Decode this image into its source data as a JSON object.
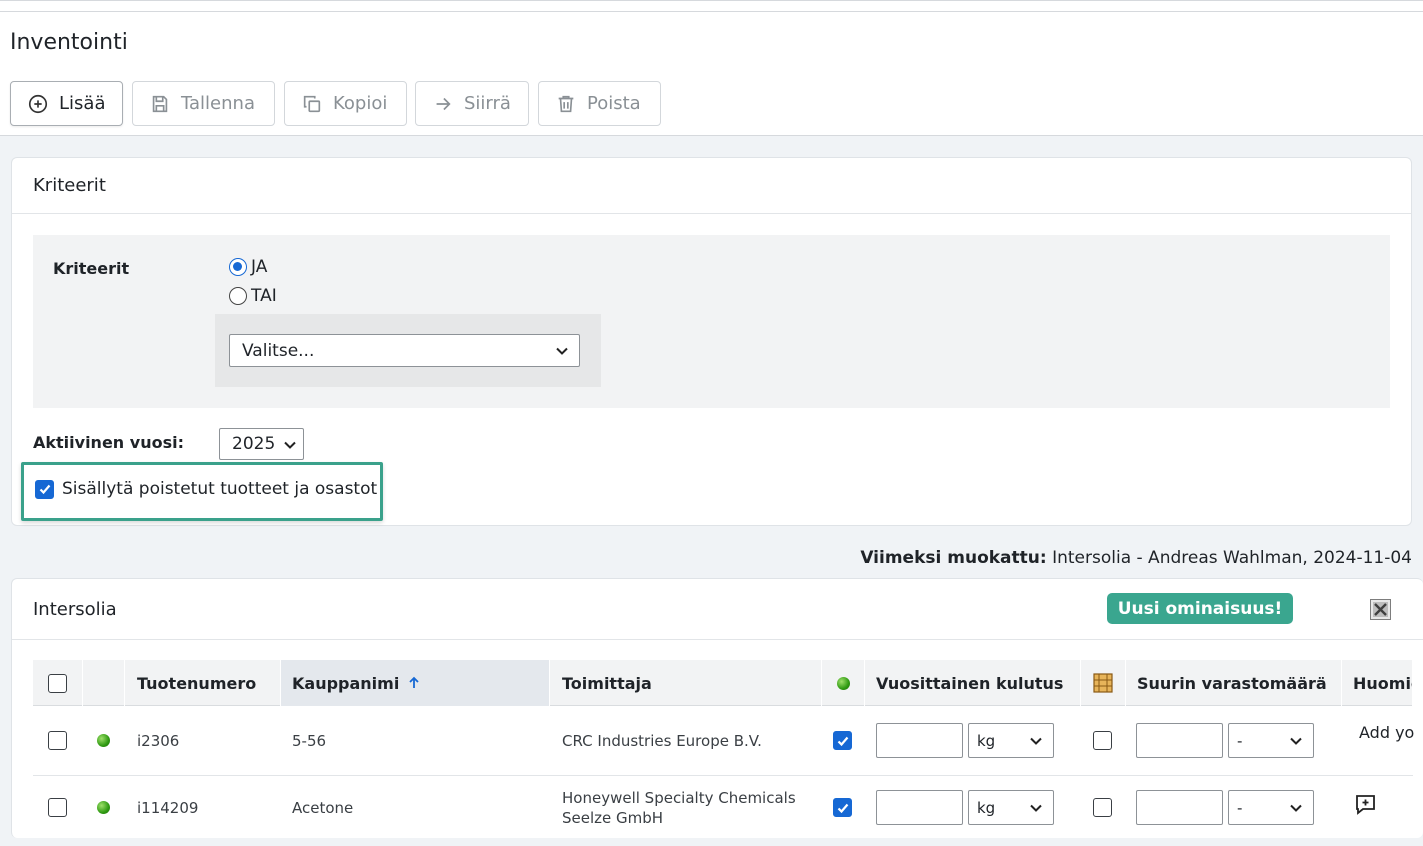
{
  "page": {
    "title": "Inventointi"
  },
  "toolbar": {
    "add": "Lisää",
    "save": "Tallenna",
    "copy": "Kopioi",
    "move": "Siirrä",
    "delete": "Poista"
  },
  "criteria_card": {
    "header": "Kriteerit",
    "label": "Kriteerit",
    "radio_and": "JA",
    "radio_or": "TAI",
    "select_value": "Valitse...",
    "year_label": "Aktiivinen vuosi:",
    "year_value": "2025",
    "include_deleted_label": "Sisällytä poistetut tuotteet ja osastot",
    "include_deleted_checked": true
  },
  "last_modified": {
    "label": "Viimeksi muokattu:",
    "value": "Intersolia - Andreas Wahlman, 2024-11-04"
  },
  "list_card": {
    "header": "Intersolia",
    "new_feature_button": "Uusi ominaisuus!",
    "columns": {
      "product_number": "Tuotenumero",
      "trade_name": "Kauppanimi",
      "supplier": "Toimittaja",
      "annual_consumption": "Vuosittainen kulutus",
      "max_storage": "Suurin varastomäärä",
      "notes": "Huomio"
    },
    "rows": [
      {
        "product_number": "i2306",
        "trade_name": "5-56",
        "supplier": "CRC Industries Europe B.V.",
        "active_checked": true,
        "unit": "kg",
        "storage_unit": "-",
        "note": "Add yo"
      },
      {
        "product_number": "i114209",
        "trade_name": "Acetone",
        "supplier": "Honeywell Specialty Chemicals Seelze GmbH",
        "active_checked": true,
        "unit": "kg",
        "storage_unit": "-",
        "note": ""
      }
    ]
  },
  "colors": {
    "accent": "#1668d4",
    "feature_button": "#3aa68f",
    "highlight_border": "#3aa18b"
  }
}
